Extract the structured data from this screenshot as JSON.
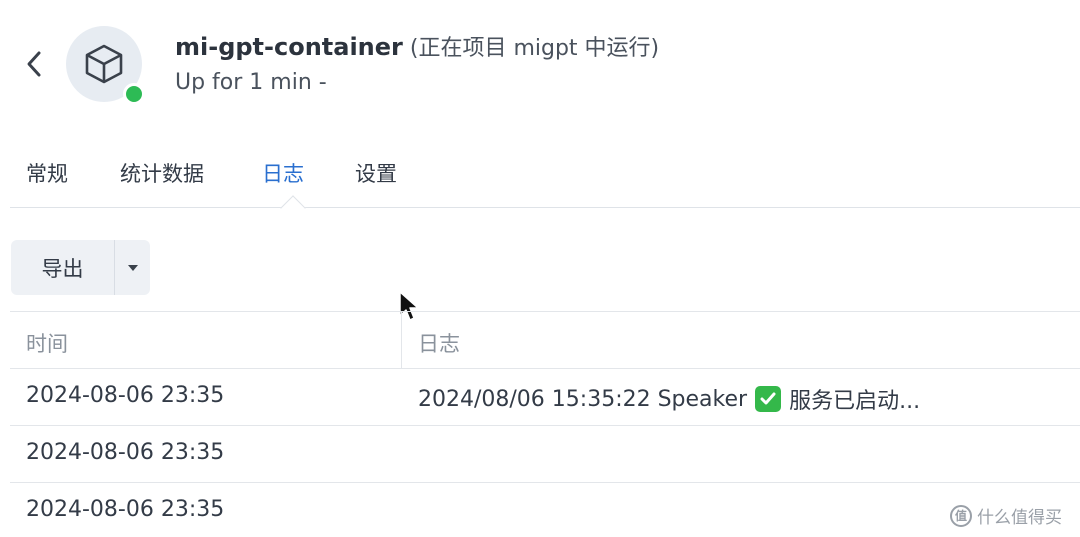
{
  "header": {
    "container_name": "mi-gpt-container",
    "project_note": " (正在项目 migpt 中运行)",
    "status": "Up for 1 min -",
    "status_color": "#2dbb55"
  },
  "tabs": [
    {
      "label": "常规",
      "active": false
    },
    {
      "label": "统计数据",
      "active": false
    },
    {
      "label": "日志",
      "active": true
    },
    {
      "label": "设置",
      "active": false
    }
  ],
  "toolbar": {
    "export_label": "导出",
    "dropdown_icon": "caret-down-icon"
  },
  "table": {
    "columns": [
      "时间",
      "日志"
    ],
    "rows": [
      {
        "time": "2024-08-06 23:35",
        "log_prefix": "2024/08/06 15:35:22 Speaker",
        "log_suffix": "服务已启动...",
        "icon": "check-mark-icon"
      },
      {
        "time": "2024-08-06 23:35",
        "log_prefix": "",
        "log_suffix": ""
      },
      {
        "time": "2024-08-06 23:35",
        "log_prefix": "",
        "log_suffix": ""
      }
    ]
  },
  "colors": {
    "accent": "#2a6fcf",
    "check_green": "#34b84a"
  },
  "watermark": {
    "logo_text": "值",
    "text": "什么值得买"
  }
}
